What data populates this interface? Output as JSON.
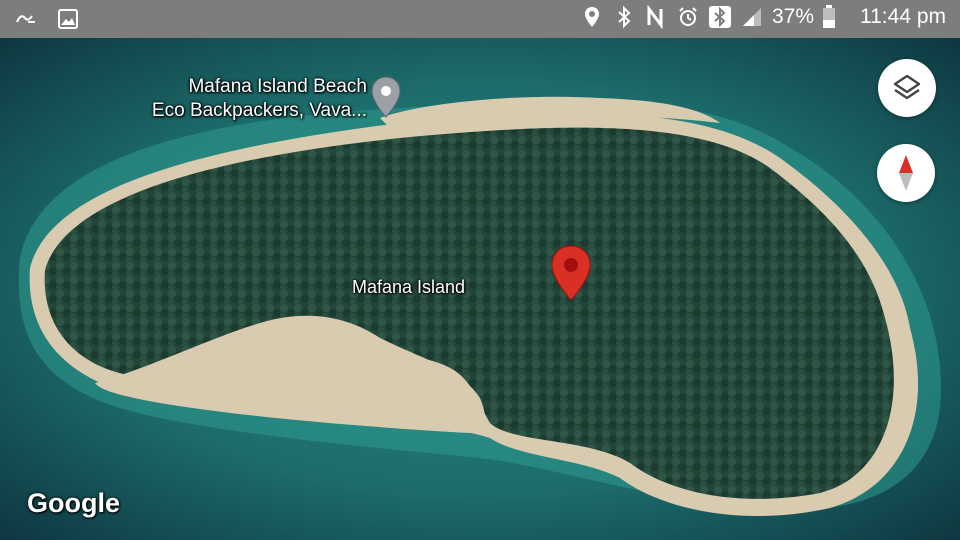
{
  "status_bar": {
    "battery_percent": "37%",
    "time": "11:44 pm",
    "icons_left": [
      "app-icon",
      "image-icon"
    ],
    "icons_right": [
      "location-icon",
      "bluetooth-icon",
      "nfc-icon",
      "alarm-icon",
      "bluetooth-badge-icon",
      "signal-icon",
      "battery-icon"
    ]
  },
  "map": {
    "poi_label_line1": "Mafana Island Beach",
    "poi_label_line2": "Eco Backpackers, Vava...",
    "island_label": "Mafana Island",
    "logo": "Google",
    "colors": {
      "pin_red": "#d93025",
      "poi_pin_gray": "#9aa0a6",
      "water": "#1c6b6a",
      "forest": "#24463a",
      "sand": "#d9cbb0"
    }
  },
  "controls": {
    "layers_button": "layers-icon",
    "compass_button": "compass-icon"
  }
}
